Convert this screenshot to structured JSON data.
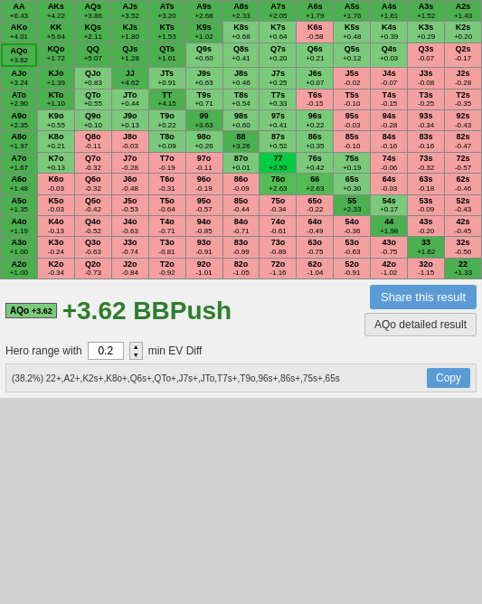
{
  "grid": {
    "cells": [
      [
        {
          "hand": "AA",
          "ev": "+6.43",
          "color": "green-dark"
        },
        {
          "hand": "AKs",
          "ev": "+4.22",
          "color": "green-dark"
        },
        {
          "hand": "AQs",
          "ev": "+3.86",
          "color": "green-dark"
        },
        {
          "hand": "AJs",
          "ev": "+3.52",
          "color": "green-dark"
        },
        {
          "hand": "ATs",
          "ev": "+3.20",
          "color": "green-dark"
        },
        {
          "hand": "A9s",
          "ev": "+2.68",
          "color": "green-dark"
        },
        {
          "hand": "A8s",
          "ev": "+2.33",
          "color": "green-dark"
        },
        {
          "hand": "A7s",
          "ev": "+2.05",
          "color": "green-dark"
        },
        {
          "hand": "A6s",
          "ev": "+1.79",
          "color": "green-dark"
        },
        {
          "hand": "A5s",
          "ev": "+1.76",
          "color": "green-dark"
        },
        {
          "hand": "A4s",
          "ev": "+1.61",
          "color": "green-dark"
        },
        {
          "hand": "A3s",
          "ev": "+1.52",
          "color": "green-dark"
        },
        {
          "hand": "A2s",
          "ev": "+1.43",
          "color": "green-dark"
        }
      ],
      [
        {
          "hand": "AKo",
          "ev": "+4.01",
          "color": "green-dark"
        },
        {
          "hand": "KK",
          "ev": "+5.64",
          "color": "green-dark"
        },
        {
          "hand": "KQs",
          "ev": "+2.11",
          "color": "green-dark"
        },
        {
          "hand": "KJs",
          "ev": "+1.80",
          "color": "green-dark"
        },
        {
          "hand": "KTs",
          "ev": "+1.53",
          "color": "green-dark"
        },
        {
          "hand": "K9s",
          "ev": "+1.02",
          "color": "green-dark"
        },
        {
          "hand": "K8s",
          "ev": "+0.68",
          "color": "green-med"
        },
        {
          "hand": "K7s",
          "ev": "+0.64",
          "color": "green-med"
        },
        {
          "hand": "K6s",
          "ev": "-0.58",
          "color": "red-light"
        },
        {
          "hand": "K5s",
          "ev": "+0.48",
          "color": "green-med"
        },
        {
          "hand": "K4s",
          "ev": "+0.39",
          "color": "green-med"
        },
        {
          "hand": "K3s",
          "ev": "+0.29",
          "color": "green-med"
        },
        {
          "hand": "K2s",
          "ev": "+0.20",
          "color": "green-med"
        }
      ],
      [
        {
          "hand": "AQo",
          "ev": "+3.62",
          "color": "green-dark",
          "highlight": true
        },
        {
          "hand": "KQo",
          "ev": "+1.72",
          "color": "green-dark"
        },
        {
          "hand": "QQ",
          "ev": "+5.07",
          "color": "green-dark"
        },
        {
          "hand": "QJs",
          "ev": "+1.28",
          "color": "green-dark"
        },
        {
          "hand": "QTs",
          "ev": "+1.01",
          "color": "green-dark"
        },
        {
          "hand": "Q9s",
          "ev": "+0.60",
          "color": "green-med"
        },
        {
          "hand": "Q8s",
          "ev": "+0.41",
          "color": "green-med"
        },
        {
          "hand": "Q7s",
          "ev": "+0.20",
          "color": "green-med"
        },
        {
          "hand": "Q6s",
          "ev": "+0.21",
          "color": "green-med"
        },
        {
          "hand": "Q5s",
          "ev": "+0.12",
          "color": "green-med"
        },
        {
          "hand": "Q4s",
          "ev": "+0.03",
          "color": "green-med"
        },
        {
          "hand": "Q3s",
          "ev": "-0.07",
          "color": "red-light"
        },
        {
          "hand": "Q2s",
          "ev": "-0.17",
          "color": "red-light"
        }
      ],
      [
        {
          "hand": "AJo",
          "ev": "+3.24",
          "color": "green-dark"
        },
        {
          "hand": "KJo",
          "ev": "+1.39",
          "color": "green-dark"
        },
        {
          "hand": "QJo",
          "ev": "+0.83",
          "color": "green-med"
        },
        {
          "hand": "JJ",
          "ev": "+4.62",
          "color": "green-dark"
        },
        {
          "hand": "JTs",
          "ev": "+0.91",
          "color": "green-med"
        },
        {
          "hand": "J9s",
          "ev": "+0.63",
          "color": "green-med"
        },
        {
          "hand": "J8s",
          "ev": "+0.46",
          "color": "green-med"
        },
        {
          "hand": "J7s",
          "ev": "+0.25",
          "color": "green-med"
        },
        {
          "hand": "J6s",
          "ev": "+0.07",
          "color": "green-med"
        },
        {
          "hand": "J5s",
          "ev": "-0.02",
          "color": "red-light"
        },
        {
          "hand": "J4s",
          "ev": "-0.07",
          "color": "red-light"
        },
        {
          "hand": "J3s",
          "ev": "-0.08",
          "color": "red-light"
        },
        {
          "hand": "J2s",
          "ev": "-0.28",
          "color": "red-light"
        }
      ],
      [
        {
          "hand": "ATo",
          "ev": "+2.90",
          "color": "green-dark"
        },
        {
          "hand": "KTo",
          "ev": "+1.10",
          "color": "green-dark"
        },
        {
          "hand": "QTo",
          "ev": "+0.55",
          "color": "green-med"
        },
        {
          "hand": "JTo",
          "ev": "+0.44",
          "color": "green-med"
        },
        {
          "hand": "TT",
          "ev": "+4.15",
          "color": "green-dark"
        },
        {
          "hand": "T9s",
          "ev": "+0.71",
          "color": "green-med"
        },
        {
          "hand": "T8s",
          "ev": "+0.54",
          "color": "green-med"
        },
        {
          "hand": "T7s",
          "ev": "+0.33",
          "color": "green-med"
        },
        {
          "hand": "T6s",
          "ev": "-0.15",
          "color": "red-light"
        },
        {
          "hand": "T5s",
          "ev": "-0.10",
          "color": "red-light"
        },
        {
          "hand": "T4s",
          "ev": "-0.15",
          "color": "red-light"
        },
        {
          "hand": "T3s",
          "ev": "-0.25",
          "color": "red-light"
        },
        {
          "hand": "T2s",
          "ev": "-0.35",
          "color": "red-light"
        }
      ],
      [
        {
          "hand": "A9o",
          "ev": "+2.35",
          "color": "green-dark"
        },
        {
          "hand": "K9o",
          "ev": "+0.55",
          "color": "green-med"
        },
        {
          "hand": "Q9o",
          "ev": "+0.10",
          "color": "green-med"
        },
        {
          "hand": "J9o",
          "ev": "+0.13",
          "color": "green-med"
        },
        {
          "hand": "T9o",
          "ev": "+0.22",
          "color": "green-med"
        },
        {
          "hand": "99",
          "ev": "+3.63",
          "color": "green-dark"
        },
        {
          "hand": "98s",
          "ev": "+0.60",
          "color": "green-med"
        },
        {
          "hand": "97s",
          "ev": "+0.41",
          "color": "green-med"
        },
        {
          "hand": "96s",
          "ev": "+0.22",
          "color": "green-med"
        },
        {
          "hand": "95s",
          "ev": "-0.03",
          "color": "red-light"
        },
        {
          "hand": "94s",
          "ev": "-0.28",
          "color": "red-light"
        },
        {
          "hand": "93s",
          "ev": "-0.34",
          "color": "red-light"
        },
        {
          "hand": "92s",
          "ev": "-0.43",
          "color": "red-light"
        }
      ],
      [
        {
          "hand": "A8o",
          "ev": "+1.97",
          "color": "green-dark"
        },
        {
          "hand": "K8o",
          "ev": "+0.21",
          "color": "green-med"
        },
        {
          "hand": "Q8o",
          "ev": "-0.11",
          "color": "red-light"
        },
        {
          "hand": "J8o",
          "ev": "-0.03",
          "color": "red-light"
        },
        {
          "hand": "T8o",
          "ev": "+0.09",
          "color": "green-med"
        },
        {
          "hand": "98o",
          "ev": "+0.26",
          "color": "green-med"
        },
        {
          "hand": "88",
          "ev": "+3.26",
          "color": "green-dark"
        },
        {
          "hand": "87s",
          "ev": "+0.52",
          "color": "green-med"
        },
        {
          "hand": "86s",
          "ev": "+0.35",
          "color": "green-med"
        },
        {
          "hand": "85s",
          "ev": "-0.10",
          "color": "red-light"
        },
        {
          "hand": "84s",
          "ev": "-0.16",
          "color": "red-light"
        },
        {
          "hand": "83s",
          "ev": "-0.16",
          "color": "red-light"
        },
        {
          "hand": "82s",
          "ev": "-0.47",
          "color": "red-light"
        }
      ],
      [
        {
          "hand": "A7o",
          "ev": "+1.67",
          "color": "green-dark"
        },
        {
          "hand": "K7o",
          "ev": "+0.13",
          "color": "green-med"
        },
        {
          "hand": "Q7o",
          "ev": "-0.32",
          "color": "red-light"
        },
        {
          "hand": "J7o",
          "ev": "-0.28",
          "color": "red-light"
        },
        {
          "hand": "T7o",
          "ev": "-0.19",
          "color": "red-light"
        },
        {
          "hand": "97o",
          "ev": "-0.11",
          "color": "red-light"
        },
        {
          "hand": "87o",
          "ev": "+0.01",
          "color": "green-med"
        },
        {
          "hand": "77",
          "ev": "+2.93",
          "color": "green-dark",
          "special": "highlight77"
        },
        {
          "hand": "76s",
          "ev": "+0.42",
          "color": "green-med"
        },
        {
          "hand": "75s",
          "ev": "+0.19",
          "color": "green-med"
        },
        {
          "hand": "74s",
          "ev": "-0.06",
          "color": "red-light"
        },
        {
          "hand": "73s",
          "ev": "-0.32",
          "color": "red-light"
        },
        {
          "hand": "72s",
          "ev": "-0.57",
          "color": "red-light"
        }
      ],
      [
        {
          "hand": "A6o",
          "ev": "+1.48",
          "color": "green-dark"
        },
        {
          "hand": "K6o",
          "ev": "-0.03",
          "color": "red-light"
        },
        {
          "hand": "Q6o",
          "ev": "-0.32",
          "color": "red-light"
        },
        {
          "hand": "J6o",
          "ev": "-0.48",
          "color": "red-light"
        },
        {
          "hand": "T6o",
          "ev": "-0.31",
          "color": "red-light"
        },
        {
          "hand": "96o",
          "ev": "-0.19",
          "color": "red-light"
        },
        {
          "hand": "86o",
          "ev": "-0.09",
          "color": "red-light"
        },
        {
          "hand": "76o",
          "ev": "+2.63",
          "color": "green-dark",
          "special": "highlight76o"
        },
        {
          "hand": "66",
          "ev": "+2.63",
          "color": "green-dark"
        },
        {
          "hand": "65s",
          "ev": "+0.30",
          "color": "green-med"
        },
        {
          "hand": "64s",
          "ev": "-0.03",
          "color": "red-light"
        },
        {
          "hand": "63s",
          "ev": "-0.18",
          "color": "red-light"
        },
        {
          "hand": "62s",
          "ev": "-0.46",
          "color": "red-light"
        }
      ],
      [
        {
          "hand": "A5o",
          "ev": "+1.35",
          "color": "green-dark"
        },
        {
          "hand": "K5o",
          "ev": "-0.03",
          "color": "red-light"
        },
        {
          "hand": "Q5o",
          "ev": "-0.42",
          "color": "red-light"
        },
        {
          "hand": "J5o",
          "ev": "-0.53",
          "color": "red-light"
        },
        {
          "hand": "T5o",
          "ev": "-0.64",
          "color": "red-light"
        },
        {
          "hand": "95o",
          "ev": "-0.57",
          "color": "red-light"
        },
        {
          "hand": "85o",
          "ev": "-0.44",
          "color": "red-light"
        },
        {
          "hand": "75o",
          "ev": "-0.34",
          "color": "red-light"
        },
        {
          "hand": "65o",
          "ev": "-0.22",
          "color": "red-light"
        },
        {
          "hand": "55",
          "ev": "+2.33",
          "color": "green-dark"
        },
        {
          "hand": "54s",
          "ev": "+0.17",
          "color": "green-med"
        },
        {
          "hand": "53s",
          "ev": "-0.09",
          "color": "red-light"
        },
        {
          "hand": "52s",
          "ev": "-0.43",
          "color": "red-light"
        }
      ],
      [
        {
          "hand": "A4o",
          "ev": "+1.19",
          "color": "green-dark"
        },
        {
          "hand": "K4o",
          "ev": "-0.13",
          "color": "red-light"
        },
        {
          "hand": "Q4o",
          "ev": "-0.52",
          "color": "red-light"
        },
        {
          "hand": "J4o",
          "ev": "-0.63",
          "color": "red-light"
        },
        {
          "hand": "T4o",
          "ev": "-0.71",
          "color": "red-light"
        },
        {
          "hand": "94o",
          "ev": "-0.85",
          "color": "red-light"
        },
        {
          "hand": "84o",
          "ev": "-0.71",
          "color": "red-light"
        },
        {
          "hand": "74o",
          "ev": "-0.61",
          "color": "red-light"
        },
        {
          "hand": "64o",
          "ev": "-0.49",
          "color": "red-light"
        },
        {
          "hand": "54o",
          "ev": "-0.36",
          "color": "red-light"
        },
        {
          "hand": "44",
          "ev": "+1.98",
          "color": "green-dark"
        },
        {
          "hand": "43s",
          "ev": "-0.20",
          "color": "red-light"
        },
        {
          "hand": "42s",
          "ev": "-0.45",
          "color": "red-light"
        }
      ],
      [
        {
          "hand": "A3o",
          "ev": "+1.00",
          "color": "green-dark"
        },
        {
          "hand": "K3o",
          "ev": "-0.24",
          "color": "red-light"
        },
        {
          "hand": "Q3o",
          "ev": "-0.63",
          "color": "red-light"
        },
        {
          "hand": "J3o",
          "ev": "-0.74",
          "color": "red-light"
        },
        {
          "hand": "T3o",
          "ev": "-0.81",
          "color": "red-light"
        },
        {
          "hand": "93o",
          "ev": "-0.91",
          "color": "red-light"
        },
        {
          "hand": "83o",
          "ev": "-0.99",
          "color": "red-light"
        },
        {
          "hand": "73o",
          "ev": "-0.89",
          "color": "red-light"
        },
        {
          "hand": "63o",
          "ev": "-0.75",
          "color": "red-light"
        },
        {
          "hand": "53o",
          "ev": "-0.63",
          "color": "red-light"
        },
        {
          "hand": "43o",
          "ev": "-0.75",
          "color": "red-light"
        },
        {
          "hand": "33",
          "ev": "+1.62",
          "color": "green-dark"
        },
        {
          "hand": "32s",
          "ev": "-0.56",
          "color": "red-light"
        }
      ],
      [
        {
          "hand": "A2o",
          "ev": "+1.00",
          "color": "green-dark"
        },
        {
          "hand": "K2o",
          "ev": "-0.34",
          "color": "red-light"
        },
        {
          "hand": "Q2o",
          "ev": "-0.73",
          "color": "red-light"
        },
        {
          "hand": "J2o",
          "ev": "-0.84",
          "color": "red-light"
        },
        {
          "hand": "T2o",
          "ev": "-0.92",
          "color": "red-light"
        },
        {
          "hand": "92o",
          "ev": "-1.01",
          "color": "red-light"
        },
        {
          "hand": "82o",
          "ev": "-1.05",
          "color": "red-light"
        },
        {
          "hand": "72o",
          "ev": "-1.16",
          "color": "red-light"
        },
        {
          "hand": "62o",
          "ev": "-1.04",
          "color": "red-light"
        },
        {
          "hand": "52o",
          "ev": "-0.91",
          "color": "red-light"
        },
        {
          "hand": "42o",
          "ev": "-1.02",
          "color": "red-light"
        },
        {
          "hand": "32o",
          "ev": "-1.15",
          "color": "red-light"
        },
        {
          "hand": "22",
          "ev": "+1.33",
          "color": "green-dark"
        }
      ]
    ]
  },
  "result": {
    "hand": "AQo",
    "ev_label": "+3.62",
    "push_label": "BBPush",
    "badge_ev": "+3.62"
  },
  "buttons": {
    "share_label": "Share this result",
    "detail_label": "AQo detailed result",
    "copy_label": "Copy"
  },
  "hero_range": {
    "label": "Hero range with",
    "ev_value": "0.2",
    "ev_suffix": "min EV Diff"
  },
  "range_string": "(38.2%) 22+,A2+,K2s+,K8o+,Q6s+,QTo+,J7s+,JTo,T7s+,T9o,96s+,86s+,75s+,65s"
}
